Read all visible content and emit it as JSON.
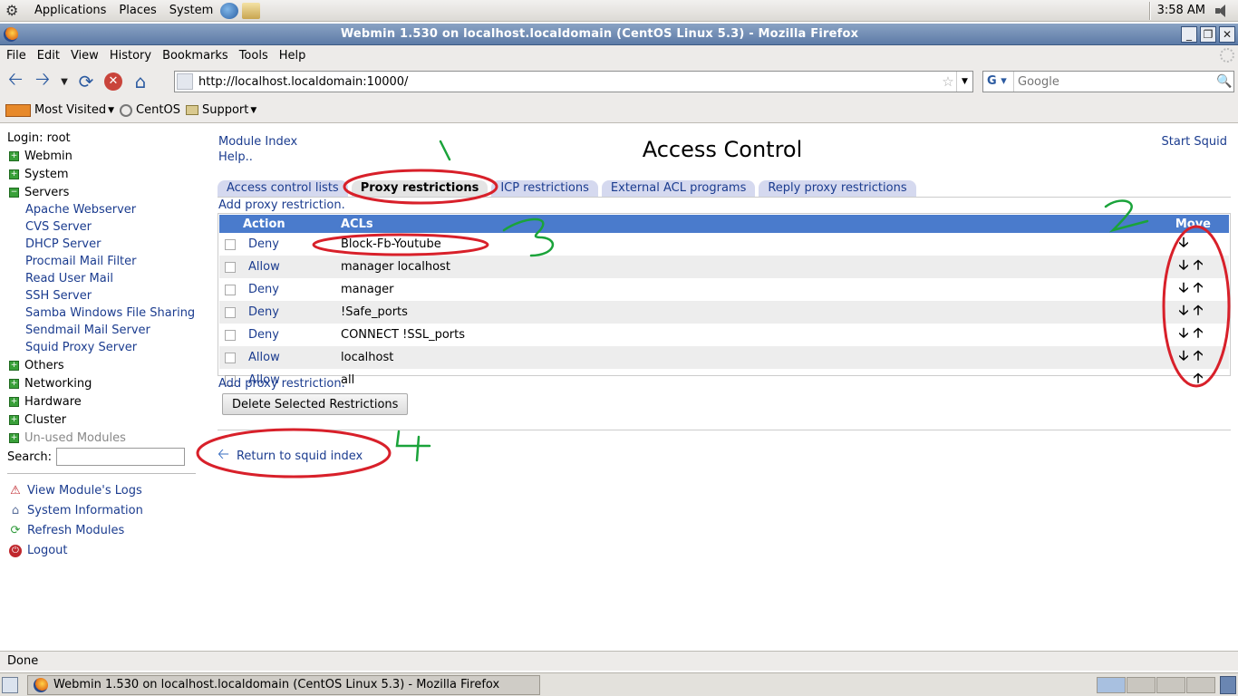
{
  "panel": {
    "menus": [
      "Applications",
      "Places",
      "System"
    ],
    "clock": "3:58 AM"
  },
  "window": {
    "title": "Webmin 1.530 on localhost.localdomain (CentOS Linux 5.3) - Mozilla Firefox"
  },
  "menubar": [
    "File",
    "Edit",
    "View",
    "History",
    "Bookmarks",
    "Tools",
    "Help"
  ],
  "navbar": {
    "url": "http://localhost.localdomain:10000/",
    "search_placeholder": "Google",
    "search_engine": "G"
  },
  "bookmarks": [
    "Most Visited",
    "CentOS",
    "Support"
  ],
  "left": {
    "login": "Login: root",
    "categories": [
      {
        "label": "Webmin"
      },
      {
        "label": "System"
      },
      {
        "label": "Servers"
      }
    ],
    "servers": [
      "Apache Webserver",
      "CVS Server",
      "DHCP Server",
      "Procmail Mail Filter",
      "Read User Mail",
      "SSH Server",
      "Samba Windows File Sharing",
      "Sendmail Mail Server",
      "Squid Proxy Server"
    ],
    "categories2": [
      "Others",
      "Networking",
      "Hardware",
      "Cluster",
      "Un-used Modules"
    ],
    "search_label": "Search:",
    "actions": [
      "View Module's Logs",
      "System Information",
      "Refresh Modules",
      "Logout"
    ]
  },
  "main": {
    "module_index": "Module Index",
    "help": "Help..",
    "title": "Access Control",
    "start_squid": "Start Squid",
    "tabs": [
      "Access control lists",
      "Proxy restrictions",
      "ICP restrictions",
      "External ACL programs",
      "Reply proxy restrictions"
    ],
    "add_link": "Add proxy restriction.",
    "columns": {
      "action": "Action",
      "acls": "ACLs",
      "move": "Move"
    },
    "rows": [
      {
        "action": "Deny",
        "acls": "Block-Fb-Youtube",
        "down": "🡣",
        "up": ""
      },
      {
        "action": "Allow",
        "acls": "manager localhost",
        "down": "🡣",
        "up": "🡡"
      },
      {
        "action": "Deny",
        "acls": "manager",
        "down": "🡣",
        "up": "🡡"
      },
      {
        "action": "Deny",
        "acls": "!Safe_ports",
        "down": "🡣",
        "up": "🡡"
      },
      {
        "action": "Deny",
        "acls": "CONNECT !SSL_ports",
        "down": "🡣",
        "up": "🡡"
      },
      {
        "action": "Allow",
        "acls": "localhost",
        "down": "🡣",
        "up": "🡡"
      },
      {
        "action": "Allow",
        "acls": "all",
        "down": "",
        "up": "🡡"
      }
    ],
    "delete_button": "Delete Selected Restrictions",
    "return_link": "Return to squid index"
  },
  "annotations": {
    "numbers": [
      "1",
      "2",
      "3",
      "4"
    ],
    "circle_color": "#d8202a",
    "number_color": "#1aa33a"
  },
  "statusbar": "Done",
  "taskbar": {
    "task_title": "Webmin 1.530 on localhost.localdomain (CentOS Linux 5.3) - Mozilla Firefox"
  },
  "colors": {
    "link": "#1b3c8f",
    "table_header": "#4a7bcc",
    "tab_bg": "#d5d9ef"
  }
}
